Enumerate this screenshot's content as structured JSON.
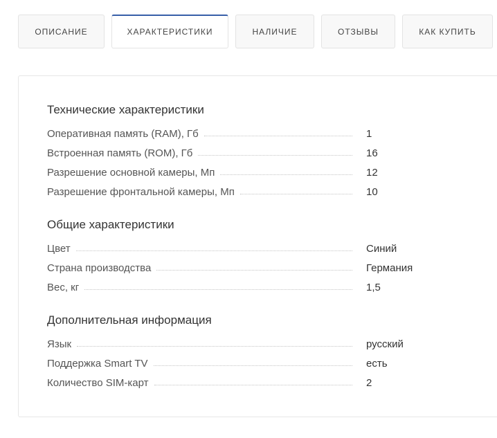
{
  "tabs": [
    {
      "label": "Описание",
      "active": false
    },
    {
      "label": "Характеристики",
      "active": true
    },
    {
      "label": "Наличие",
      "active": false
    },
    {
      "label": "Отзывы",
      "active": false
    },
    {
      "label": "Как купить",
      "active": false
    }
  ],
  "colors": {
    "accent": "#365ea8",
    "border": "#e3e3e3",
    "text": "#333333",
    "muted_text": "#555555"
  },
  "groups": [
    {
      "title": "Технические характеристики",
      "props": [
        {
          "name": "Оперативная память (RAM), Гб",
          "value": "1"
        },
        {
          "name": "Встроенная память (ROM), Гб",
          "value": "16"
        },
        {
          "name": "Разрешение основной камеры, Мп",
          "value": "12"
        },
        {
          "name": "Разрешение фронтальной камеры, Мп",
          "value": "10"
        }
      ]
    },
    {
      "title": "Общие характеристики",
      "props": [
        {
          "name": "Цвет",
          "value": "Синий"
        },
        {
          "name": "Страна производства",
          "value": "Германия"
        },
        {
          "name": "Вес, кг",
          "value": "1,5"
        }
      ]
    },
    {
      "title": "Дополнительная информация",
      "props": [
        {
          "name": "Язык",
          "value": "русский"
        },
        {
          "name": "Поддержка Smart TV",
          "value": "есть"
        },
        {
          "name": "Количество SIM-карт",
          "value": "2"
        }
      ]
    }
  ]
}
